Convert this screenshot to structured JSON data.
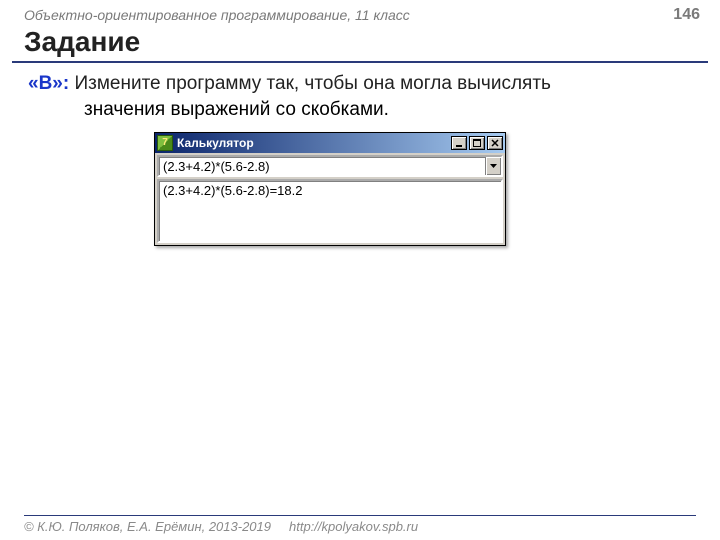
{
  "header": {
    "course": "Объектно-ориентированное программирование, 11 класс",
    "page": "146"
  },
  "title": "Задание",
  "task": {
    "label": "«B»:",
    "line1": "Измените программу так, чтобы она могла вычислять",
    "line2": "значения выражений со скобками."
  },
  "window": {
    "icon_char": "7",
    "caption": "Калькулятор",
    "input_value": "(2.3+4.2)*(5.6-2.8)",
    "output_value": "(2.3+4.2)*(5.6-2.8)=18.2"
  },
  "footer": {
    "copyright": "© К.Ю. Поляков, Е.А. Ерёмин, 2013-2019",
    "url": "http://kpolyakov.spb.ru"
  }
}
